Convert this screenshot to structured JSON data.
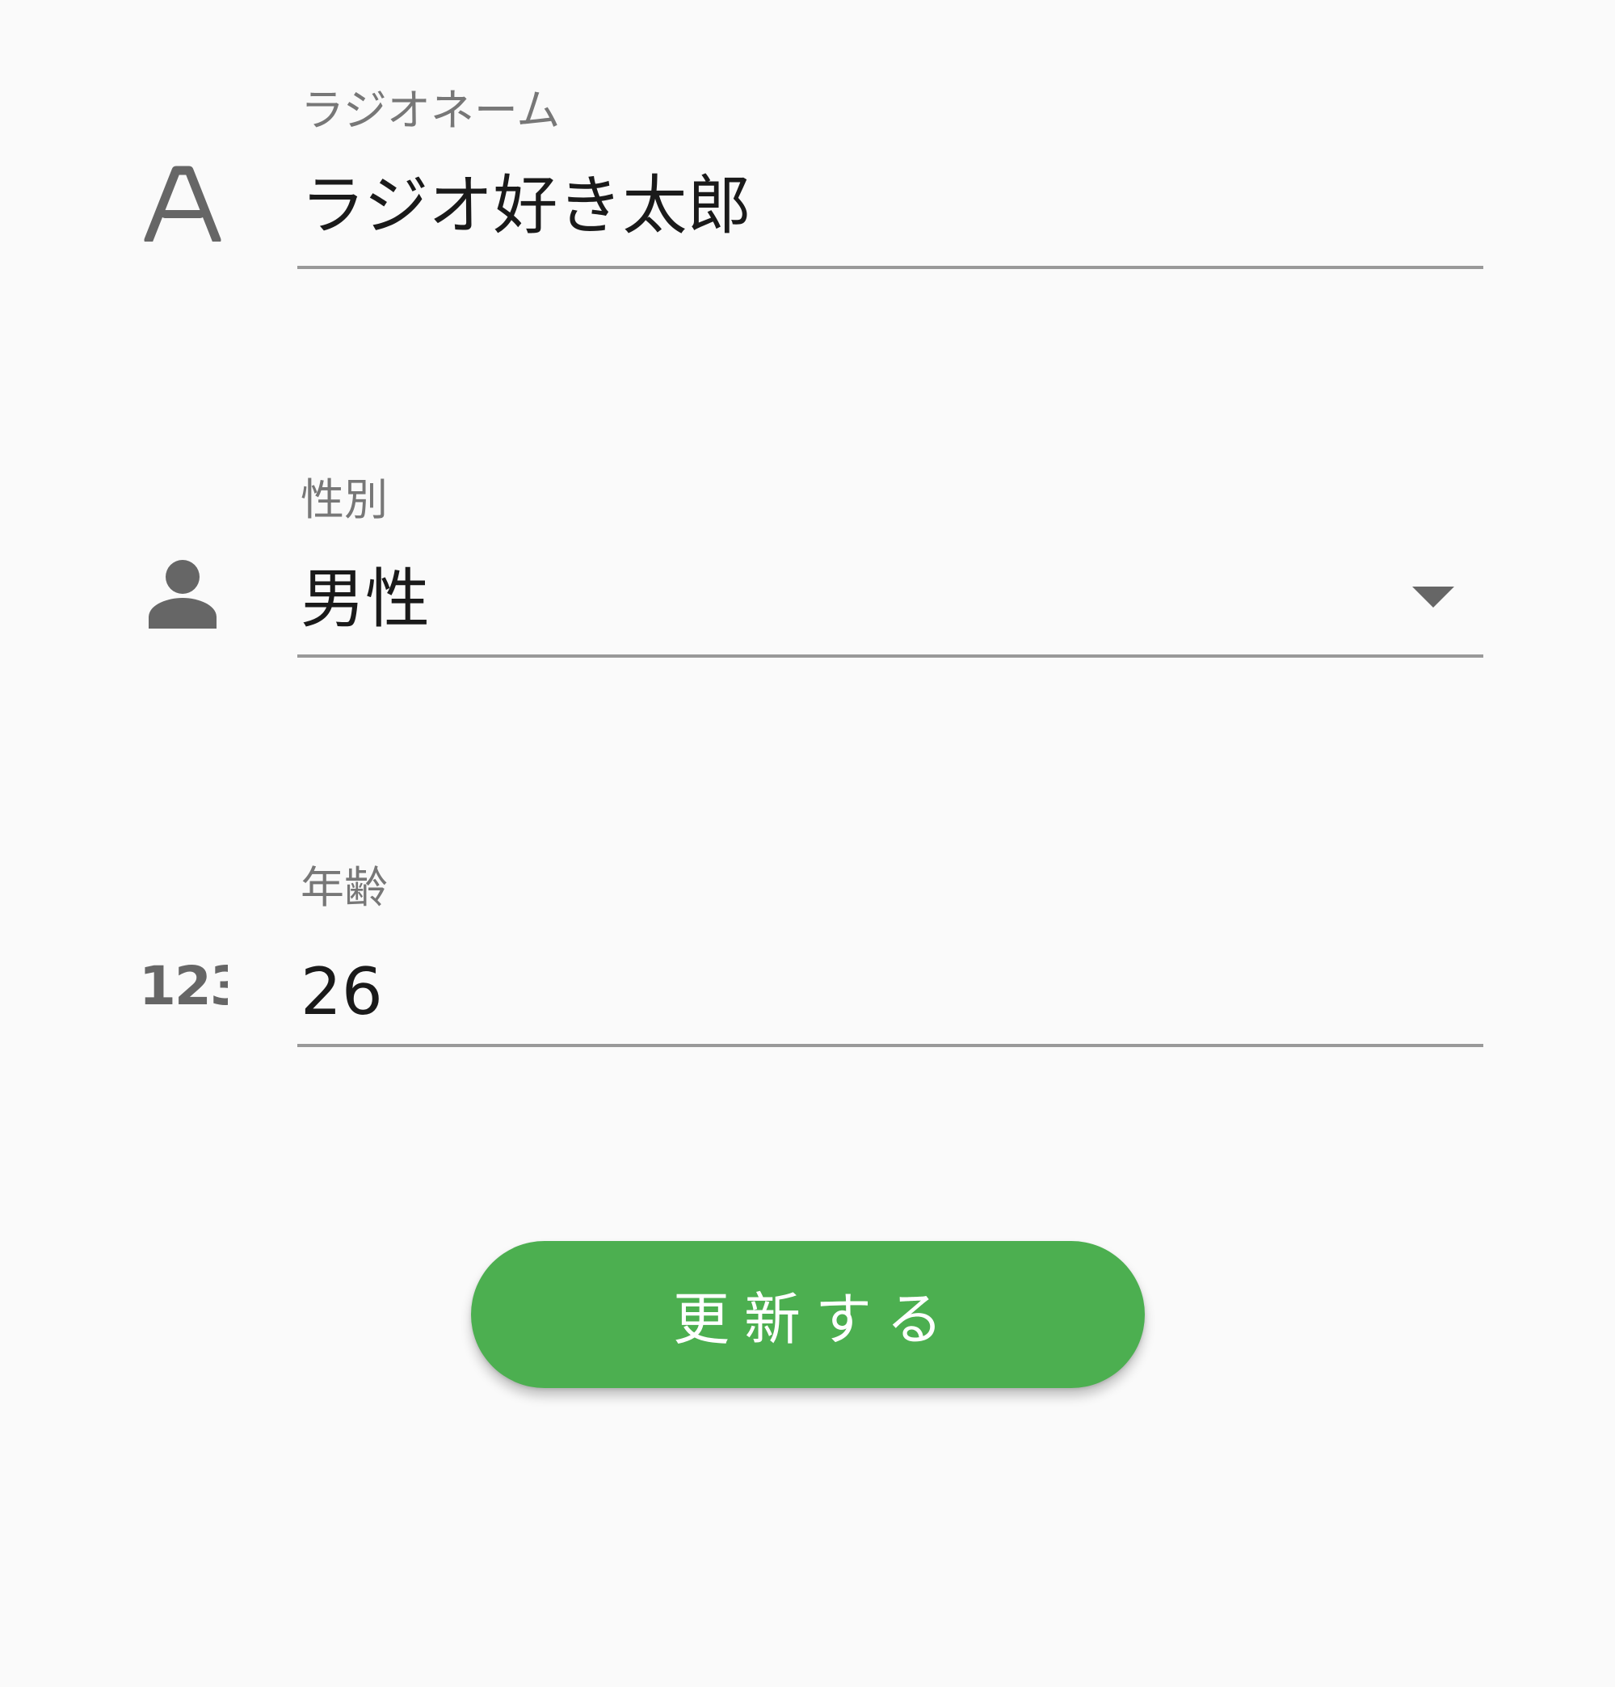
{
  "form": {
    "radio_name": {
      "label": "ラジオネーム",
      "value": "ラジオ好き太郎",
      "icon": "text-format-icon"
    },
    "gender": {
      "label": "性別",
      "value": "男性",
      "icon": "person-icon"
    },
    "age": {
      "label": "年齢",
      "value": "26",
      "icon": "numeric-icon"
    }
  },
  "actions": {
    "update_label": "更新する"
  },
  "colors": {
    "accent": "#4caf50",
    "icon": "#666666",
    "label": "#777777",
    "underline": "#999999",
    "background": "#fafafa"
  }
}
